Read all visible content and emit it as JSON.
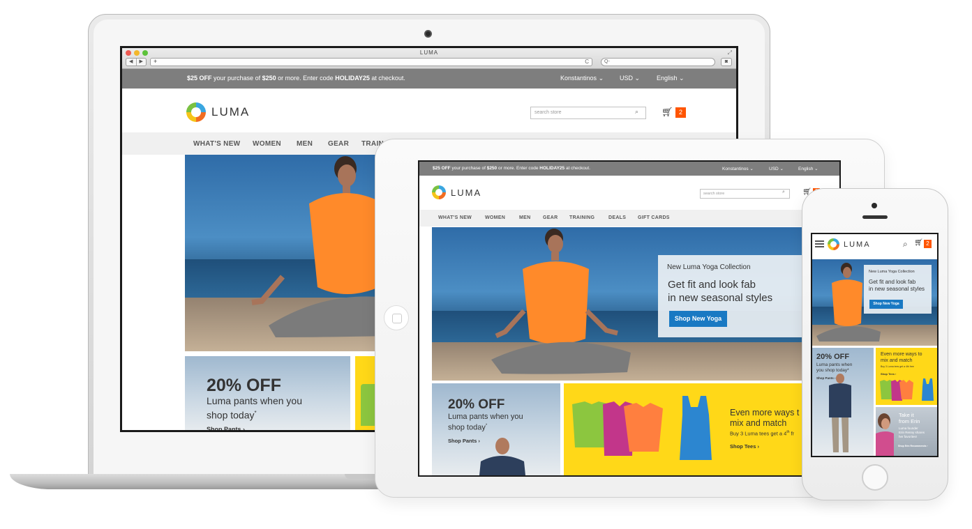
{
  "browser": {
    "title": "LUMA",
    "back": "◀",
    "forward": "▶",
    "new_tab": "+",
    "reload": "C",
    "search_glyph": "Q-"
  },
  "promo": {
    "amount": "$25 OFF",
    "text1": "your purchase of",
    "threshold": "$250",
    "text2": "or more.  Enter code",
    "code": "HOLIDAY25",
    "text3": "at checkout."
  },
  "header": {
    "account": "Konstantinos",
    "currency": "USD",
    "language": "English",
    "chevron": "⌄"
  },
  "logo": {
    "text": "LUMA"
  },
  "search": {
    "placeholder": "search store"
  },
  "cart": {
    "count": "2"
  },
  "nav": {
    "items": [
      "WHAT'S NEW",
      "WOMEN",
      "MEN",
      "GEAR",
      "TRAINING",
      "DEALS",
      "GIFT CARDS"
    ],
    "laptop_truncated": "TRAIN"
  },
  "hero": {
    "eyebrow": "New Luma Yoga Collection",
    "headline1": "Get fit and look fab",
    "headline2": "in new seasonal styles",
    "cta": "Shop New Yoga"
  },
  "pants_promo": {
    "headline": "20% OFF",
    "line1": "Luma pants when you",
    "line2": "shop today",
    "asterisk": "*",
    "cta": "Shop Pants"
  },
  "tees_promo": {
    "line1": "Even more ways t",
    "line2": "mix and match",
    "line3": "Buy 3 Luma tees get a 4",
    "sup": "th",
    "tail": " fr",
    "cta": "Shop Tees"
  },
  "phone_tees": {
    "line1": "Even more ways to",
    "line2": "mix and match",
    "line3": "Buy 3 Luma tees get a 4th free",
    "cta": "Shop Tees"
  },
  "phone_pants": {
    "headline": "20% OFF",
    "line1": "Luma pants when",
    "line2": "you shop today*",
    "cta": "Shop Pants"
  },
  "erin": {
    "line1": "Take it",
    "line2": "from Erin",
    "sub1": "Luma founder",
    "sub2": "Erin Renny shares",
    "sub3": "her favorites!",
    "cta": "Shop Erin Recommends"
  },
  "colors": {
    "accent": "#ff5501",
    "button": "#1979c3",
    "promo_bar": "#7e7e7e",
    "yellow": "#ffd818"
  }
}
